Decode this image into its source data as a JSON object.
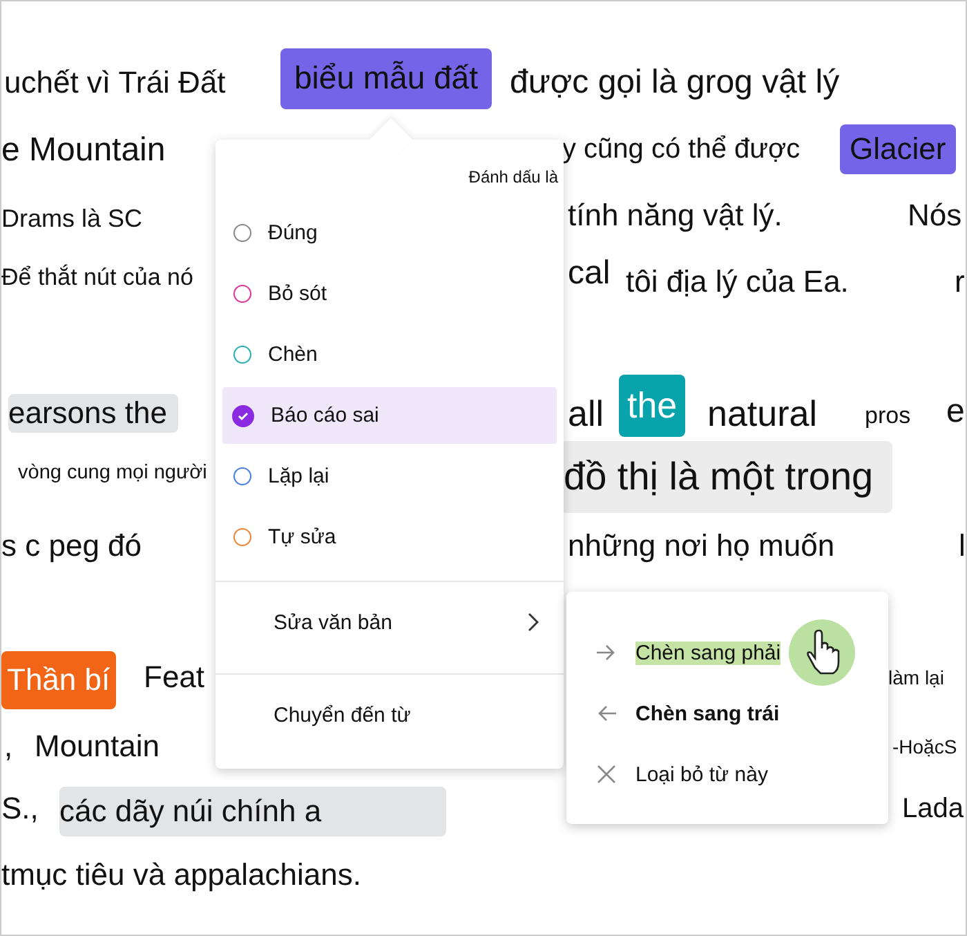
{
  "passage": {
    "fragments": [
      {
        "text": "uchết vì Trái Đất"
      },
      {
        "text": "biểu mẫu đất",
        "color": "#7464e8",
        "inverse": false
      },
      {
        "text": "được gọi là grog vật lý"
      },
      {
        "text": "e"
      },
      {
        "text": "Mountain"
      },
      {
        "text": "y cũng có thể được"
      },
      {
        "text": "Glacier",
        "color": "#7464e8",
        "inverse": false
      },
      {
        "text": "Drams là SC"
      },
      {
        "text": "tính năng vật lý."
      },
      {
        "text": "Nós"
      },
      {
        "text": "Để thắt nút của nó"
      },
      {
        "text": "cal"
      },
      {
        "text": "tôi địa lý của Ea."
      },
      {
        "text": "r"
      },
      {
        "text": "earsons the",
        "color": "#e3e4e6",
        "inverse": false
      },
      {
        "text": "all"
      },
      {
        "text": "the",
        "color": "#08a3ab",
        "inverse": true
      },
      {
        "text": "natural"
      },
      {
        "text": "pros"
      },
      {
        "text": "e"
      },
      {
        "text": "vòng cung mọi người"
      },
      {
        "text": "đồ thị là một trong",
        "color": "#ececec",
        "inverse": false
      },
      {
        "text": "s c peg đó"
      },
      {
        "text": "những nơi họ muốn"
      },
      {
        "text": "l"
      },
      {
        "text": "Thần bí",
        "color": "#f26516",
        "inverse": true
      },
      {
        "text": "Feat"
      },
      {
        "text": "làm lại"
      },
      {
        "text": ","
      },
      {
        "text": "Mountain"
      },
      {
        "text": "-HoặcS"
      },
      {
        "text": "S.,"
      },
      {
        "text": "các dãy núi chính a",
        "color": "#e3e4e6",
        "inverse": false
      },
      {
        "text": "Lada"
      },
      {
        "text": "tmục tiêu và appalachians."
      }
    ]
  },
  "menu": {
    "header": "Đánh dấu là",
    "options": [
      {
        "label": "Đúng",
        "color": "#8a8a8a",
        "checked": false,
        "selected": false
      },
      {
        "label": "Bỏ sót",
        "color": "#e0369a",
        "checked": false,
        "selected": false
      },
      {
        "label": "Chèn",
        "color": "#2aaeb4",
        "checked": false,
        "selected": false
      },
      {
        "label": "Báo cáo sai",
        "color": "#8a2be2",
        "checked": true,
        "selected": true
      },
      {
        "label": "Lặp lại",
        "color": "#4a7ee8",
        "checked": false,
        "selected": false
      },
      {
        "label": "Tự sửa",
        "color": "#f08436",
        "checked": false,
        "selected": false
      }
    ],
    "actions": [
      {
        "label": "Sửa văn bản",
        "submenu": true
      },
      {
        "label": "Chuyển đến từ",
        "submenu": false
      }
    ]
  },
  "submenu": {
    "items": [
      {
        "kind": "arrow-right",
        "label": "Chèn sang phải",
        "selected": true,
        "bold": false
      },
      {
        "kind": "arrow-left",
        "label": "Chèn sang trái",
        "selected": false,
        "bold": true
      },
      {
        "kind": "remove",
        "label": "Loại bỏ từ này",
        "selected": false,
        "bold": false
      }
    ]
  }
}
